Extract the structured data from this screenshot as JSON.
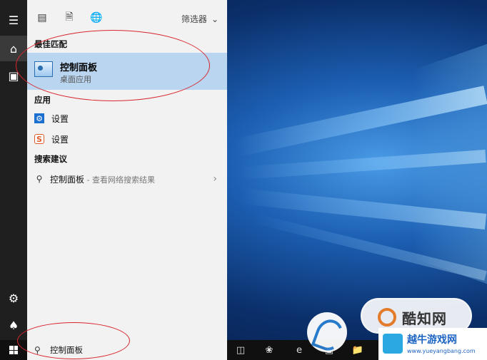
{
  "top_bar": {
    "icons": [
      "document-view-icon",
      "file-icon",
      "globe-icon"
    ],
    "filter_label": "筛选器"
  },
  "sections": {
    "best_match": "最佳匹配",
    "apps": "应用",
    "suggestions": "搜索建议"
  },
  "best_match": {
    "title": "控制面板",
    "subtitle": "桌面应用"
  },
  "apps": [
    {
      "label": "设置",
      "icon": "gear-icon"
    },
    {
      "label": "设置",
      "icon": "sogou-icon",
      "glyph": "S"
    }
  ],
  "suggestion": {
    "label": "控制面板",
    "sub": " - 查看网络搜索结果"
  },
  "search_box": {
    "value": "控制面板"
  },
  "watermarks": {
    "badge": "酷知网",
    "corner_title": "越牛游戏网",
    "corner_url": "www.yueyangbang.com"
  },
  "colors": {
    "best_match_highlight": "#b9d5ef",
    "annotation": "#d8262e",
    "rail": "#1f1f1f"
  }
}
